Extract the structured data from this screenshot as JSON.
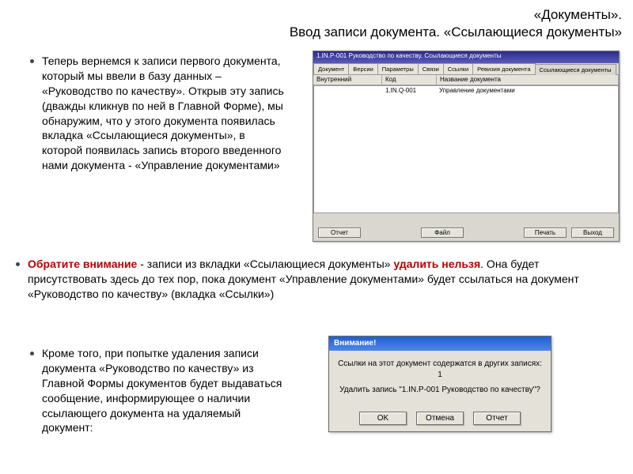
{
  "title": {
    "line1": "«Документы».",
    "line2": "Ввод записи документа. «Ссылающиеся документы»"
  },
  "bullets": {
    "first": "Теперь вернемся к записи первого документа, который мы ввели в базу данных – «Руководство по качеству». Открыв эту запись (дважды кликнув по ней в Главной Форме), мы обнаружим, что у этого документа появилась вкладка «Ссылающиеся документы», в которой появилась запись второго введенного нами документа  - «Управление документами»",
    "note_prefix": "Обратите внимание",
    "note_mid": " -  записи из вкладки «Ссылающиеся документы» ",
    "note_bold2": "удалить нельзя",
    "note_tail": ". Она будет присутствовать здесь до тех пор, пока документ «Управление документами» будет ссылаться на документ «Руководство по качеству» (вкладка «Ссылки»)",
    "third": "Кроме того, при попытке удаления записи документа «Руководство по качеству» из Главной Формы документов будет выдаваться сообщение, информирующее о наличии ссылающего документа на удаляемый документ:"
  },
  "window": {
    "title": "1.IN.P-001 Руководство по качеству. Ссылающиеся документы",
    "tabs": [
      "Документ",
      "Версии",
      "Параметры",
      "Связи",
      "Ссылки",
      "Ревизия документа",
      "Ссылающиеся документы"
    ],
    "active_tab": 6,
    "columns": [
      "Внутренний",
      "Код",
      "Название документа"
    ],
    "row": {
      "col1": "",
      "col2": "1.IN.Q-001",
      "col3": "Управление документами"
    },
    "buttons": {
      "left": "Отчет",
      "mid": "Файл",
      "right1": "Печать",
      "right2": "Выход"
    }
  },
  "dialog": {
    "title": "Внимание!",
    "line1": "Ссылки на этот документ содержатся в других записях: 1",
    "line2": "Удалить запись \"1.IN.P-001 Руководство по качеству\"?",
    "buttons": {
      "ok": "OK",
      "cancel": "Отмена",
      "report": "Отчет"
    }
  }
}
